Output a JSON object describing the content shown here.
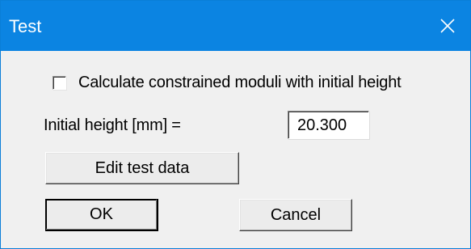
{
  "window": {
    "title": "Test"
  },
  "titlebar": {
    "close_icon": "close-icon",
    "color": "#0b84e2"
  },
  "form": {
    "checkbox_label": "Calculate constrained moduli with initial height",
    "checkbox_checked": false,
    "height_label": "Initial height [mm] =",
    "height_value": "20.300"
  },
  "buttons": {
    "edit_label": "Edit test data",
    "ok_label": "OK",
    "cancel_label": "Cancel"
  }
}
